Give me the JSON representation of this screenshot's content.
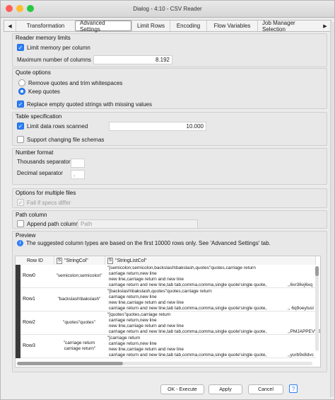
{
  "window": {
    "title": "Dialog - 4:10 - CSV Reader",
    "light_colors": [
      "#ff5f57",
      "#febc2e",
      "#28c840"
    ]
  },
  "tabs": [
    {
      "label": "Transformation"
    },
    {
      "label": "Advanced Settings"
    },
    {
      "label": "Limit Rows"
    },
    {
      "label": "Encoding"
    },
    {
      "label": "Flow Variables"
    },
    {
      "label": "Job Manager Selection"
    }
  ],
  "tab_arrows": {
    "left": "◀",
    "right": "▶"
  },
  "reader_memory": {
    "title": "Reader memory limits",
    "limit_memory_label": "Limit memory per column",
    "max_columns_label": "Maximum number of columns",
    "max_columns_value": "8.192"
  },
  "quote_options": {
    "title": "Quote options",
    "remove_quotes_label": "Remove quotes and trim whitespaces",
    "keep_quotes_label": "Keep quotes",
    "replace_empty_label": "Replace empty quoted strings with missing values"
  },
  "table_spec": {
    "title": "Table specification",
    "limit_rows_label": "Limit data rows scanned",
    "limit_rows_value": "10.000",
    "support_changing_label": "Support changing file schemas"
  },
  "number_format": {
    "title": "Number format",
    "thousands_label": "Thousands separator",
    "thousands_value": "",
    "decimal_label": "Decimal separator",
    "decimal_value": "."
  },
  "multiple_files": {
    "title": "Options for multiple files",
    "fail_label": "Fail if specs differ"
  },
  "path_column": {
    "title": "Path column",
    "append_label": "Append path column",
    "placeholder": "Path"
  },
  "preview": {
    "title": "Preview",
    "info_text": "The suggested column types are based on the first 10000 rows only. See 'Advanced Settings' tab.",
    "info_icon": "i",
    "columns": [
      {
        "label": "Row ID",
        "badge": ""
      },
      {
        "label": "\"StringCol\"",
        "badge": "S"
      },
      {
        "label": "\"StringListCol\"",
        "badge": "S"
      }
    ],
    "rows": [
      {
        "id": "Row0",
        "c1": "\"semicolon;semicolon\"",
        "c2": "\"[semicolon;semicolon,backslash\\bakslash,quotes\"quotes,carriage return\n carriage return,new line\n new line,carriage return and new line\n carriage return and new line,tab tab,comma,comma,single quote'single quote,",
        "c3": ",,6xr36vj6xq"
      },
      {
        "id": "Row1",
        "c1": "\"backslash\\bakslash\"",
        "c2": "\"[backslash\\bakslash,quotes\"quotes,carriage return\n carriage return,new line\n new line,carriage return and new line\n carriage return and new line,tab tab,comma,comma,single quote'single quote,",
        "c3": ",, 6q9oeytusl"
      },
      {
        "id": "Row2",
        "c1": "\"quotes\"quotes\"",
        "c2": "\"[quotes\"quotes,carriage return\n carriage return,new line\n new line,carriage return and new line\n carriage return and new line,tab tab,comma,comma,single quote'single quote,",
        "c3": ",,PMJAPPEVVS"
      },
      {
        "id": "Row3",
        "c1": "\"carriage return\n carriage return\"",
        "c2": "\"[carriage return\n carriage return,new line\n new line,carriage return and new line\n carriage return and new line,tab tab,comma,comma,single quote'single quote,",
        "c3": ",,yurb9x8dvc"
      }
    ]
  },
  "buttons": {
    "ok": "OK - Execute",
    "apply": "Apply",
    "cancel": "Cancel",
    "help": "?"
  }
}
